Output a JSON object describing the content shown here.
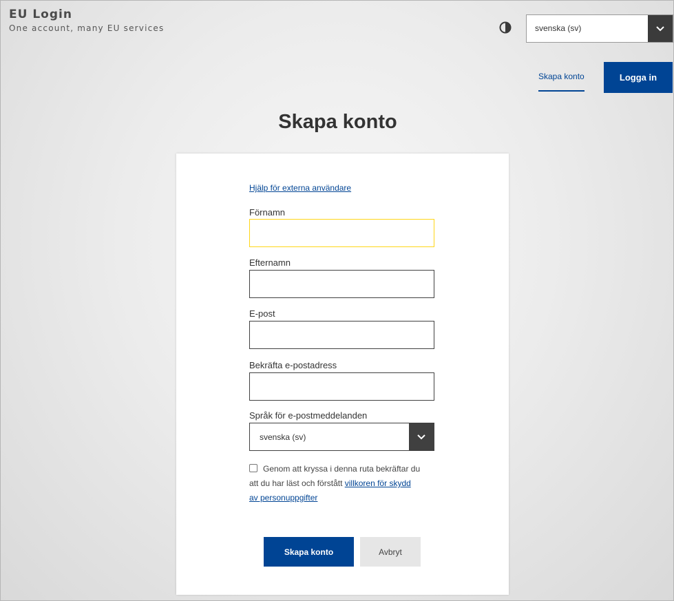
{
  "header": {
    "title": "EU Login",
    "subtitle": "One account, many EU services",
    "contrast_icon": "contrast-icon",
    "language": "svenska (sv)"
  },
  "nav": {
    "create_account": "Skapa konto",
    "login": "Logga in"
  },
  "page": {
    "title": "Skapa konto"
  },
  "form": {
    "help_link": "Hjälp för externa användare",
    "first_name_label": "Förnamn",
    "first_name_value": "",
    "last_name_label": "Efternamn",
    "last_name_value": "",
    "email_label": "E-post",
    "email_value": "",
    "confirm_email_label": "Bekräfta e-postadress",
    "confirm_email_value": "",
    "mail_language_label": "Språk för e-postmeddelanden",
    "mail_language_value": "svenska (sv)",
    "consent_text": "Genom att kryssa i denna ruta bekräftar du att du har läst och förstått",
    "consent_link": "villkoren för skydd av personuppgifter",
    "consent_checked": false,
    "submit_label": "Skapa konto",
    "cancel_label": "Avbryt"
  },
  "colors": {
    "primary": "#004494",
    "focus": "#ffd617",
    "dark": "#404040"
  }
}
